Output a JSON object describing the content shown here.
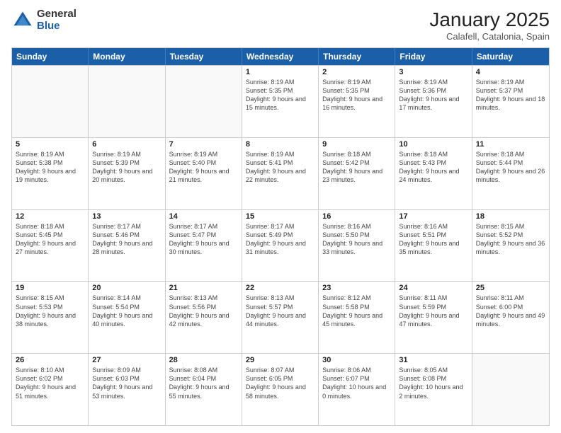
{
  "logo": {
    "general": "General",
    "blue": "Blue"
  },
  "title": "January 2025",
  "subtitle": "Calafell, Catalonia, Spain",
  "headers": [
    "Sunday",
    "Monday",
    "Tuesday",
    "Wednesday",
    "Thursday",
    "Friday",
    "Saturday"
  ],
  "weeks": [
    [
      {
        "day": "",
        "sunrise": "",
        "sunset": "",
        "daylight": ""
      },
      {
        "day": "",
        "sunrise": "",
        "sunset": "",
        "daylight": ""
      },
      {
        "day": "",
        "sunrise": "",
        "sunset": "",
        "daylight": ""
      },
      {
        "day": "1",
        "sunrise": "Sunrise: 8:19 AM",
        "sunset": "Sunset: 5:35 PM",
        "daylight": "Daylight: 9 hours and 15 minutes."
      },
      {
        "day": "2",
        "sunrise": "Sunrise: 8:19 AM",
        "sunset": "Sunset: 5:35 PM",
        "daylight": "Daylight: 9 hours and 16 minutes."
      },
      {
        "day": "3",
        "sunrise": "Sunrise: 8:19 AM",
        "sunset": "Sunset: 5:36 PM",
        "daylight": "Daylight: 9 hours and 17 minutes."
      },
      {
        "day": "4",
        "sunrise": "Sunrise: 8:19 AM",
        "sunset": "Sunset: 5:37 PM",
        "daylight": "Daylight: 9 hours and 18 minutes."
      }
    ],
    [
      {
        "day": "5",
        "sunrise": "Sunrise: 8:19 AM",
        "sunset": "Sunset: 5:38 PM",
        "daylight": "Daylight: 9 hours and 19 minutes."
      },
      {
        "day": "6",
        "sunrise": "Sunrise: 8:19 AM",
        "sunset": "Sunset: 5:39 PM",
        "daylight": "Daylight: 9 hours and 20 minutes."
      },
      {
        "day": "7",
        "sunrise": "Sunrise: 8:19 AM",
        "sunset": "Sunset: 5:40 PM",
        "daylight": "Daylight: 9 hours and 21 minutes."
      },
      {
        "day": "8",
        "sunrise": "Sunrise: 8:19 AM",
        "sunset": "Sunset: 5:41 PM",
        "daylight": "Daylight: 9 hours and 22 minutes."
      },
      {
        "day": "9",
        "sunrise": "Sunrise: 8:18 AM",
        "sunset": "Sunset: 5:42 PM",
        "daylight": "Daylight: 9 hours and 23 minutes."
      },
      {
        "day": "10",
        "sunrise": "Sunrise: 8:18 AM",
        "sunset": "Sunset: 5:43 PM",
        "daylight": "Daylight: 9 hours and 24 minutes."
      },
      {
        "day": "11",
        "sunrise": "Sunrise: 8:18 AM",
        "sunset": "Sunset: 5:44 PM",
        "daylight": "Daylight: 9 hours and 26 minutes."
      }
    ],
    [
      {
        "day": "12",
        "sunrise": "Sunrise: 8:18 AM",
        "sunset": "Sunset: 5:45 PM",
        "daylight": "Daylight: 9 hours and 27 minutes."
      },
      {
        "day": "13",
        "sunrise": "Sunrise: 8:17 AM",
        "sunset": "Sunset: 5:46 PM",
        "daylight": "Daylight: 9 hours and 28 minutes."
      },
      {
        "day": "14",
        "sunrise": "Sunrise: 8:17 AM",
        "sunset": "Sunset: 5:47 PM",
        "daylight": "Daylight: 9 hours and 30 minutes."
      },
      {
        "day": "15",
        "sunrise": "Sunrise: 8:17 AM",
        "sunset": "Sunset: 5:49 PM",
        "daylight": "Daylight: 9 hours and 31 minutes."
      },
      {
        "day": "16",
        "sunrise": "Sunrise: 8:16 AM",
        "sunset": "Sunset: 5:50 PM",
        "daylight": "Daylight: 9 hours and 33 minutes."
      },
      {
        "day": "17",
        "sunrise": "Sunrise: 8:16 AM",
        "sunset": "Sunset: 5:51 PM",
        "daylight": "Daylight: 9 hours and 35 minutes."
      },
      {
        "day": "18",
        "sunrise": "Sunrise: 8:15 AM",
        "sunset": "Sunset: 5:52 PM",
        "daylight": "Daylight: 9 hours and 36 minutes."
      }
    ],
    [
      {
        "day": "19",
        "sunrise": "Sunrise: 8:15 AM",
        "sunset": "Sunset: 5:53 PM",
        "daylight": "Daylight: 9 hours and 38 minutes."
      },
      {
        "day": "20",
        "sunrise": "Sunrise: 8:14 AM",
        "sunset": "Sunset: 5:54 PM",
        "daylight": "Daylight: 9 hours and 40 minutes."
      },
      {
        "day": "21",
        "sunrise": "Sunrise: 8:13 AM",
        "sunset": "Sunset: 5:56 PM",
        "daylight": "Daylight: 9 hours and 42 minutes."
      },
      {
        "day": "22",
        "sunrise": "Sunrise: 8:13 AM",
        "sunset": "Sunset: 5:57 PM",
        "daylight": "Daylight: 9 hours and 44 minutes."
      },
      {
        "day": "23",
        "sunrise": "Sunrise: 8:12 AM",
        "sunset": "Sunset: 5:58 PM",
        "daylight": "Daylight: 9 hours and 45 minutes."
      },
      {
        "day": "24",
        "sunrise": "Sunrise: 8:11 AM",
        "sunset": "Sunset: 5:59 PM",
        "daylight": "Daylight: 9 hours and 47 minutes."
      },
      {
        "day": "25",
        "sunrise": "Sunrise: 8:11 AM",
        "sunset": "Sunset: 6:00 PM",
        "daylight": "Daylight: 9 hours and 49 minutes."
      }
    ],
    [
      {
        "day": "26",
        "sunrise": "Sunrise: 8:10 AM",
        "sunset": "Sunset: 6:02 PM",
        "daylight": "Daylight: 9 hours and 51 minutes."
      },
      {
        "day": "27",
        "sunrise": "Sunrise: 8:09 AM",
        "sunset": "Sunset: 6:03 PM",
        "daylight": "Daylight: 9 hours and 53 minutes."
      },
      {
        "day": "28",
        "sunrise": "Sunrise: 8:08 AM",
        "sunset": "Sunset: 6:04 PM",
        "daylight": "Daylight: 9 hours and 55 minutes."
      },
      {
        "day": "29",
        "sunrise": "Sunrise: 8:07 AM",
        "sunset": "Sunset: 6:05 PM",
        "daylight": "Daylight: 9 hours and 58 minutes."
      },
      {
        "day": "30",
        "sunrise": "Sunrise: 8:06 AM",
        "sunset": "Sunset: 6:07 PM",
        "daylight": "Daylight: 10 hours and 0 minutes."
      },
      {
        "day": "31",
        "sunrise": "Sunrise: 8:05 AM",
        "sunset": "Sunset: 6:08 PM",
        "daylight": "Daylight: 10 hours and 2 minutes."
      },
      {
        "day": "",
        "sunrise": "",
        "sunset": "",
        "daylight": ""
      }
    ]
  ]
}
